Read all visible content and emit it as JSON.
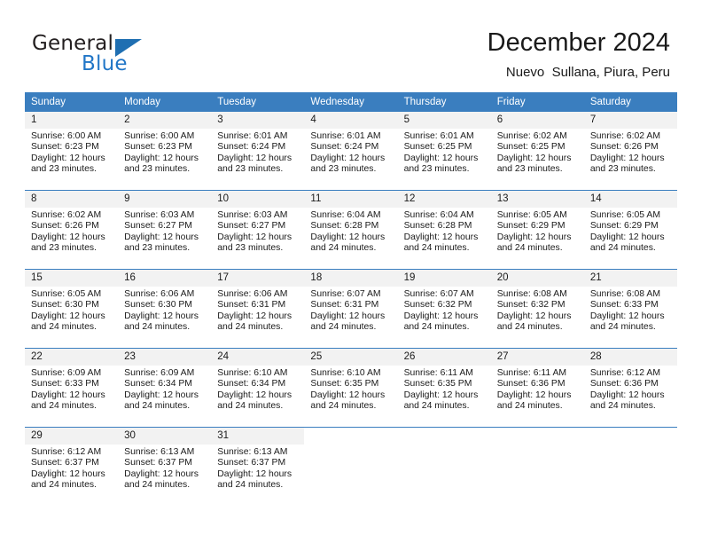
{
  "brand": {
    "name_part1": "General",
    "name_part2": "Blue",
    "logo_icon": "triangle-logo-icon",
    "accent_color": "#2176c7"
  },
  "header": {
    "title": "December 2024",
    "subtitle": "Nuevo  Sullana, Piura, Peru"
  },
  "calendar": {
    "header_color": "#3a7ebf",
    "daynum_bg": "#f2f2f2",
    "weekday_headers": [
      "Sunday",
      "Monday",
      "Tuesday",
      "Wednesday",
      "Thursday",
      "Friday",
      "Saturday"
    ],
    "weeks": [
      [
        {
          "day": "1",
          "sunrise": "Sunrise: 6:00 AM",
          "sunset": "Sunset: 6:23 PM",
          "daylight_line1": "Daylight: 12 hours",
          "daylight_line2": "and 23 minutes."
        },
        {
          "day": "2",
          "sunrise": "Sunrise: 6:00 AM",
          "sunset": "Sunset: 6:23 PM",
          "daylight_line1": "Daylight: 12 hours",
          "daylight_line2": "and 23 minutes."
        },
        {
          "day": "3",
          "sunrise": "Sunrise: 6:01 AM",
          "sunset": "Sunset: 6:24 PM",
          "daylight_line1": "Daylight: 12 hours",
          "daylight_line2": "and 23 minutes."
        },
        {
          "day": "4",
          "sunrise": "Sunrise: 6:01 AM",
          "sunset": "Sunset: 6:24 PM",
          "daylight_line1": "Daylight: 12 hours",
          "daylight_line2": "and 23 minutes."
        },
        {
          "day": "5",
          "sunrise": "Sunrise: 6:01 AM",
          "sunset": "Sunset: 6:25 PM",
          "daylight_line1": "Daylight: 12 hours",
          "daylight_line2": "and 23 minutes."
        },
        {
          "day": "6",
          "sunrise": "Sunrise: 6:02 AM",
          "sunset": "Sunset: 6:25 PM",
          "daylight_line1": "Daylight: 12 hours",
          "daylight_line2": "and 23 minutes."
        },
        {
          "day": "7",
          "sunrise": "Sunrise: 6:02 AM",
          "sunset": "Sunset: 6:26 PM",
          "daylight_line1": "Daylight: 12 hours",
          "daylight_line2": "and 23 minutes."
        }
      ],
      [
        {
          "day": "8",
          "sunrise": "Sunrise: 6:02 AM",
          "sunset": "Sunset: 6:26 PM",
          "daylight_line1": "Daylight: 12 hours",
          "daylight_line2": "and 23 minutes."
        },
        {
          "day": "9",
          "sunrise": "Sunrise: 6:03 AM",
          "sunset": "Sunset: 6:27 PM",
          "daylight_line1": "Daylight: 12 hours",
          "daylight_line2": "and 23 minutes."
        },
        {
          "day": "10",
          "sunrise": "Sunrise: 6:03 AM",
          "sunset": "Sunset: 6:27 PM",
          "daylight_line1": "Daylight: 12 hours",
          "daylight_line2": "and 23 minutes."
        },
        {
          "day": "11",
          "sunrise": "Sunrise: 6:04 AM",
          "sunset": "Sunset: 6:28 PM",
          "daylight_line1": "Daylight: 12 hours",
          "daylight_line2": "and 24 minutes."
        },
        {
          "day": "12",
          "sunrise": "Sunrise: 6:04 AM",
          "sunset": "Sunset: 6:28 PM",
          "daylight_line1": "Daylight: 12 hours",
          "daylight_line2": "and 24 minutes."
        },
        {
          "day": "13",
          "sunrise": "Sunrise: 6:05 AM",
          "sunset": "Sunset: 6:29 PM",
          "daylight_line1": "Daylight: 12 hours",
          "daylight_line2": "and 24 minutes."
        },
        {
          "day": "14",
          "sunrise": "Sunrise: 6:05 AM",
          "sunset": "Sunset: 6:29 PM",
          "daylight_line1": "Daylight: 12 hours",
          "daylight_line2": "and 24 minutes."
        }
      ],
      [
        {
          "day": "15",
          "sunrise": "Sunrise: 6:05 AM",
          "sunset": "Sunset: 6:30 PM",
          "daylight_line1": "Daylight: 12 hours",
          "daylight_line2": "and 24 minutes."
        },
        {
          "day": "16",
          "sunrise": "Sunrise: 6:06 AM",
          "sunset": "Sunset: 6:30 PM",
          "daylight_line1": "Daylight: 12 hours",
          "daylight_line2": "and 24 minutes."
        },
        {
          "day": "17",
          "sunrise": "Sunrise: 6:06 AM",
          "sunset": "Sunset: 6:31 PM",
          "daylight_line1": "Daylight: 12 hours",
          "daylight_line2": "and 24 minutes."
        },
        {
          "day": "18",
          "sunrise": "Sunrise: 6:07 AM",
          "sunset": "Sunset: 6:31 PM",
          "daylight_line1": "Daylight: 12 hours",
          "daylight_line2": "and 24 minutes."
        },
        {
          "day": "19",
          "sunrise": "Sunrise: 6:07 AM",
          "sunset": "Sunset: 6:32 PM",
          "daylight_line1": "Daylight: 12 hours",
          "daylight_line2": "and 24 minutes."
        },
        {
          "day": "20",
          "sunrise": "Sunrise: 6:08 AM",
          "sunset": "Sunset: 6:32 PM",
          "daylight_line1": "Daylight: 12 hours",
          "daylight_line2": "and 24 minutes."
        },
        {
          "day": "21",
          "sunrise": "Sunrise: 6:08 AM",
          "sunset": "Sunset: 6:33 PM",
          "daylight_line1": "Daylight: 12 hours",
          "daylight_line2": "and 24 minutes."
        }
      ],
      [
        {
          "day": "22",
          "sunrise": "Sunrise: 6:09 AM",
          "sunset": "Sunset: 6:33 PM",
          "daylight_line1": "Daylight: 12 hours",
          "daylight_line2": "and 24 minutes."
        },
        {
          "day": "23",
          "sunrise": "Sunrise: 6:09 AM",
          "sunset": "Sunset: 6:34 PM",
          "daylight_line1": "Daylight: 12 hours",
          "daylight_line2": "and 24 minutes."
        },
        {
          "day": "24",
          "sunrise": "Sunrise: 6:10 AM",
          "sunset": "Sunset: 6:34 PM",
          "daylight_line1": "Daylight: 12 hours",
          "daylight_line2": "and 24 minutes."
        },
        {
          "day": "25",
          "sunrise": "Sunrise: 6:10 AM",
          "sunset": "Sunset: 6:35 PM",
          "daylight_line1": "Daylight: 12 hours",
          "daylight_line2": "and 24 minutes."
        },
        {
          "day": "26",
          "sunrise": "Sunrise: 6:11 AM",
          "sunset": "Sunset: 6:35 PM",
          "daylight_line1": "Daylight: 12 hours",
          "daylight_line2": "and 24 minutes."
        },
        {
          "day": "27",
          "sunrise": "Sunrise: 6:11 AM",
          "sunset": "Sunset: 6:36 PM",
          "daylight_line1": "Daylight: 12 hours",
          "daylight_line2": "and 24 minutes."
        },
        {
          "day": "28",
          "sunrise": "Sunrise: 6:12 AM",
          "sunset": "Sunset: 6:36 PM",
          "daylight_line1": "Daylight: 12 hours",
          "daylight_line2": "and 24 minutes."
        }
      ],
      [
        {
          "day": "29",
          "sunrise": "Sunrise: 6:12 AM",
          "sunset": "Sunset: 6:37 PM",
          "daylight_line1": "Daylight: 12 hours",
          "daylight_line2": "and 24 minutes."
        },
        {
          "day": "30",
          "sunrise": "Sunrise: 6:13 AM",
          "sunset": "Sunset: 6:37 PM",
          "daylight_line1": "Daylight: 12 hours",
          "daylight_line2": "and 24 minutes."
        },
        {
          "day": "31",
          "sunrise": "Sunrise: 6:13 AM",
          "sunset": "Sunset: 6:37 PM",
          "daylight_line1": "Daylight: 12 hours",
          "daylight_line2": "and 24 minutes."
        },
        {
          "day": "",
          "sunrise": "",
          "sunset": "",
          "daylight_line1": "",
          "daylight_line2": ""
        },
        {
          "day": "",
          "sunrise": "",
          "sunset": "",
          "daylight_line1": "",
          "daylight_line2": ""
        },
        {
          "day": "",
          "sunrise": "",
          "sunset": "",
          "daylight_line1": "",
          "daylight_line2": ""
        },
        {
          "day": "",
          "sunrise": "",
          "sunset": "",
          "daylight_line1": "",
          "daylight_line2": ""
        }
      ]
    ]
  }
}
